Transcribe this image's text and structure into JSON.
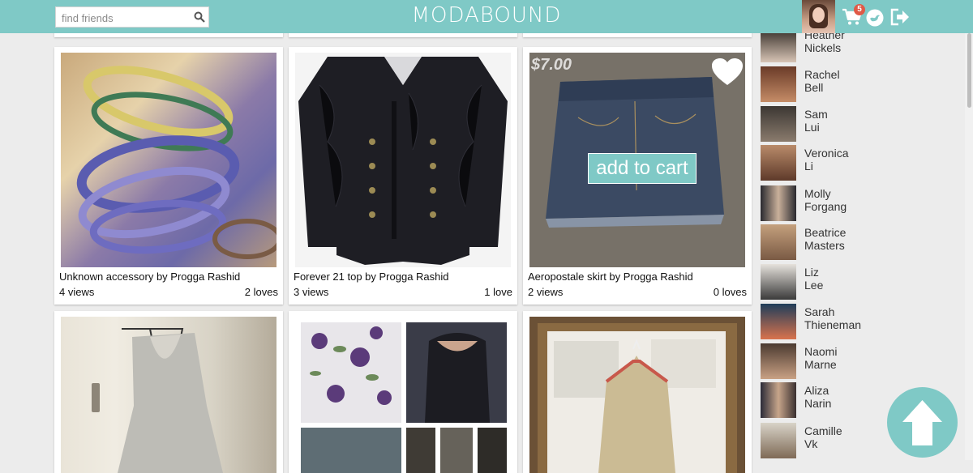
{
  "header": {
    "brand": "MODABOUND",
    "search_placeholder": "find friends",
    "cart_count": "5",
    "accent_color": "#7fc9c6",
    "icons": [
      "search-icon",
      "cart-icon",
      "bird-icon",
      "logout-icon"
    ]
  },
  "items": [
    {
      "caption": "Unknown accessory by Progga Rashid",
      "views": "4 views",
      "loves": "2 loves"
    },
    {
      "caption": "Forever 21 top by Progga Rashid",
      "views": "3 views",
      "loves": "1 love"
    },
    {
      "caption": "Aeropostale skirt by Progga Rashid",
      "views": "2 views",
      "loves": "0 loves",
      "price": "$7.00",
      "add_to_cart": "add to cart"
    }
  ],
  "friends": [
    {
      "first": "Heather",
      "last": "Nickels"
    },
    {
      "first": "Rachel",
      "last": "Bell"
    },
    {
      "first": "Sam",
      "last": "Lui"
    },
    {
      "first": "Veronica",
      "last": "Li"
    },
    {
      "first": "Molly",
      "last": "Forgang"
    },
    {
      "first": "Beatrice",
      "last": "Masters"
    },
    {
      "first": "Liz",
      "last": "Lee"
    },
    {
      "first": "Sarah",
      "last": "Thieneman"
    },
    {
      "first": "Naomi",
      "last": "Marne"
    },
    {
      "first": "Aliza",
      "last": "Narin"
    },
    {
      "first": "Camille",
      "last": "Vk"
    }
  ]
}
